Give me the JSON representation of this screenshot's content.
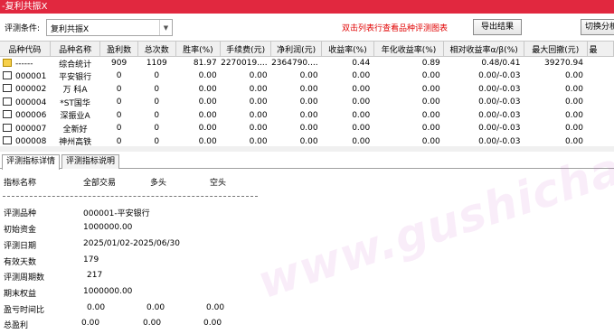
{
  "window": {
    "title": "-复利共振X"
  },
  "toolbar": {
    "condition_label": "评测条件:",
    "condition_value": "复利共振X",
    "hint": "双击列表行查看品种评测图表",
    "export_button": "导出结果",
    "switch_button": "切换分析"
  },
  "grid": {
    "columns": [
      "品种代码",
      "品种名称",
      "盈利数",
      "总次数",
      "胜率(%)",
      "手续费(元)",
      "净利润(元)",
      "收益率(%)",
      "年化收益率(%)",
      "相对收益率α/β(%)",
      "最大回撤(元)",
      "最"
    ],
    "rows": [
      {
        "code": "------",
        "name": "综合统计",
        "win": "909",
        "total": "1109",
        "rate": "81.97",
        "fee": "2270019....",
        "profit": "2364790....",
        "ret": "0.44",
        "annual": "0.89",
        "alpha": "0.48/0.41",
        "drawdown": "39270.94",
        "icon": "folder-icon"
      },
      {
        "code": "000001",
        "name": "平安银行",
        "win": "0",
        "total": "0",
        "rate": "0.00",
        "fee": "0.00",
        "profit": "0.00",
        "ret": "0.00",
        "annual": "0.00",
        "alpha": "0.00/-0.03",
        "drawdown": "0.00",
        "icon": "checkbox-icon"
      },
      {
        "code": "000002",
        "name": "万 科A",
        "win": "0",
        "total": "0",
        "rate": "0.00",
        "fee": "0.00",
        "profit": "0.00",
        "ret": "0.00",
        "annual": "0.00",
        "alpha": "0.00/-0.03",
        "drawdown": "0.00",
        "icon": "checkbox-icon"
      },
      {
        "code": "000004",
        "name": "*ST国华",
        "win": "0",
        "total": "0",
        "rate": "0.00",
        "fee": "0.00",
        "profit": "0.00",
        "ret": "0.00",
        "annual": "0.00",
        "alpha": "0.00/-0.03",
        "drawdown": "0.00",
        "icon": "checkbox-icon"
      },
      {
        "code": "000006",
        "name": "深振业A",
        "win": "0",
        "total": "0",
        "rate": "0.00",
        "fee": "0.00",
        "profit": "0.00",
        "ret": "0.00",
        "annual": "0.00",
        "alpha": "0.00/-0.03",
        "drawdown": "0.00",
        "icon": "checkbox-icon"
      },
      {
        "code": "000007",
        "name": "全新好",
        "win": "0",
        "total": "0",
        "rate": "0.00",
        "fee": "0.00",
        "profit": "0.00",
        "ret": "0.00",
        "annual": "0.00",
        "alpha": "0.00/-0.03",
        "drawdown": "0.00",
        "icon": "checkbox-icon"
      },
      {
        "code": "000008",
        "name": "神州高铁",
        "win": "0",
        "total": "0",
        "rate": "0.00",
        "fee": "0.00",
        "profit": "0.00",
        "ret": "0.00",
        "annual": "0.00",
        "alpha": "0.00/-0.03",
        "drawdown": "0.00",
        "icon": "checkbox-icon"
      }
    ]
  },
  "tabs": [
    "评测指标详情",
    "评测指标说明"
  ],
  "detail": {
    "header": {
      "name": "指标名称",
      "all": "全部交易",
      "long": "多头",
      "short": "空头"
    },
    "items": [
      {
        "label": "评测品种",
        "value": "000001-平安银行"
      },
      {
        "label": "初始资金",
        "value": "1000000.00"
      },
      {
        "label": "评测日期",
        "value": "2025/01/02-2025/06/30"
      },
      {
        "label": "有效天数",
        "value": "179"
      },
      {
        "label": "评测周期数",
        "value": "217"
      },
      {
        "label": "期末权益",
        "value": "1000000.00"
      }
    ],
    "ratio": {
      "label": "盈亏时间比",
      "all": "0.00",
      "long": "0.00",
      "short": "0.00"
    },
    "total_profit": {
      "label": "总盈利",
      "all": "0.00",
      "long": "0.00",
      "short": "0.00"
    }
  },
  "watermark": "www.gushichanghong.com",
  "colors": {
    "titlebar": "#e1283f",
    "hint": "#e00000"
  }
}
